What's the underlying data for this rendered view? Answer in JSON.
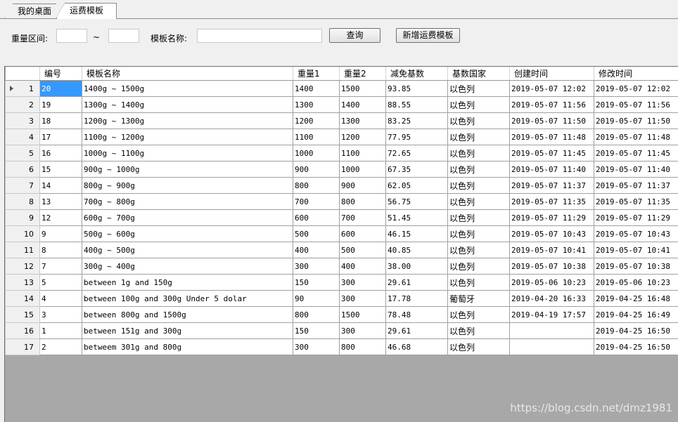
{
  "tabs": [
    {
      "label": "我的桌面"
    },
    {
      "label": "运费模板"
    }
  ],
  "filter": {
    "weight_label": "重量区间:",
    "weight_from": "",
    "tilde": "~",
    "weight_to": "",
    "name_label": "模板名称:",
    "name_value": "",
    "query_button": "查询",
    "add_button": "新增运费模板"
  },
  "table": {
    "columns": [
      "编号",
      "模板名称",
      "重量1",
      "重量2",
      "减免基数",
      "基数国家",
      "创建时间",
      "修改时间"
    ],
    "rows": [
      {
        "n": "1",
        "id": "20",
        "name": "1400g ~ 1500g",
        "w1": "1400",
        "w2": "1500",
        "base": "93.85",
        "country": "以色列",
        "created": "2019-05-07 12:02",
        "modified": "2019-05-07 12:02"
      },
      {
        "n": "2",
        "id": "19",
        "name": "1300g ~ 1400g",
        "w1": "1300",
        "w2": "1400",
        "base": "88.55",
        "country": "以色列",
        "created": "2019-05-07 11:56",
        "modified": "2019-05-07 11:56"
      },
      {
        "n": "3",
        "id": "18",
        "name": "1200g ~ 1300g",
        "w1": "1200",
        "w2": "1300",
        "base": "83.25",
        "country": "以色列",
        "created": "2019-05-07 11:50",
        "modified": "2019-05-07 11:50"
      },
      {
        "n": "4",
        "id": "17",
        "name": "1100g ~ 1200g",
        "w1": "1100",
        "w2": "1200",
        "base": "77.95",
        "country": "以色列",
        "created": "2019-05-07 11:48",
        "modified": "2019-05-07 11:48"
      },
      {
        "n": "5",
        "id": "16",
        "name": "1000g ~ 1100g",
        "w1": "1000",
        "w2": "1100",
        "base": "72.65",
        "country": "以色列",
        "created": "2019-05-07 11:45",
        "modified": "2019-05-07 11:45"
      },
      {
        "n": "6",
        "id": "15",
        "name": "900g ~ 1000g",
        "w1": "900",
        "w2": "1000",
        "base": "67.35",
        "country": "以色列",
        "created": "2019-05-07 11:40",
        "modified": "2019-05-07 11:40"
      },
      {
        "n": "7",
        "id": "14",
        "name": "800g ~ 900g",
        "w1": "800",
        "w2": "900",
        "base": "62.05",
        "country": "以色列",
        "created": "2019-05-07 11:37",
        "modified": "2019-05-07 11:37"
      },
      {
        "n": "8",
        "id": "13",
        "name": "700g ~ 800g",
        "w1": "700",
        "w2": "800",
        "base": "56.75",
        "country": "以色列",
        "created": "2019-05-07 11:35",
        "modified": "2019-05-07 11:35"
      },
      {
        "n": "9",
        "id": "12",
        "name": "600g ~ 700g",
        "w1": "600",
        "w2": "700",
        "base": "51.45",
        "country": "以色列",
        "created": "2019-05-07 11:29",
        "modified": "2019-05-07 11:29"
      },
      {
        "n": "10",
        "id": "9",
        "name": "500g ~ 600g",
        "w1": "500",
        "w2": "600",
        "base": "46.15",
        "country": "以色列",
        "created": "2019-05-07 10:43",
        "modified": "2019-05-07 10:43"
      },
      {
        "n": "11",
        "id": "8",
        "name": "400g ~ 500g",
        "w1": "400",
        "w2": "500",
        "base": "40.85",
        "country": "以色列",
        "created": "2019-05-07 10:41",
        "modified": "2019-05-07 10:41"
      },
      {
        "n": "12",
        "id": "7",
        "name": "300g ~ 400g",
        "w1": "300",
        "w2": "400",
        "base": "38.00",
        "country": "以色列",
        "created": "2019-05-07 10:38",
        "modified": "2019-05-07 10:38"
      },
      {
        "n": "13",
        "id": "5",
        "name": "between 1g and 150g",
        "w1": "150",
        "w2": "300",
        "base": "29.61",
        "country": "以色列",
        "created": "2019-05-06 10:23",
        "modified": "2019-05-06 10:23"
      },
      {
        "n": "14",
        "id": "4",
        "name": "between 100g and 300g Under 5 dolar",
        "w1": "90",
        "w2": "300",
        "base": "17.78",
        "country": "葡萄牙",
        "created": "2019-04-20 16:33",
        "modified": "2019-04-25 16:48"
      },
      {
        "n": "15",
        "id": "3",
        "name": "between 800g and 1500g",
        "w1": "800",
        "w2": "1500",
        "base": "78.48",
        "country": "以色列",
        "created": "2019-04-19 17:57",
        "modified": "2019-04-25 16:49"
      },
      {
        "n": "16",
        "id": "1",
        "name": "between 151g and 300g",
        "w1": "150",
        "w2": "300",
        "base": "29.61",
        "country": "以色列",
        "created": "",
        "modified": "2019-04-25 16:50"
      },
      {
        "n": "17",
        "id": "2",
        "name": "betweem 301g and 800g",
        "w1": "300",
        "w2": "800",
        "base": "46.68",
        "country": "以色列",
        "created": "",
        "modified": "2019-04-25 16:50"
      }
    ]
  },
  "watermark": "https://blog.csdn.net/dmz1981",
  "colors": {
    "selection": "#3399ff",
    "grid_background": "#a8a8a8"
  }
}
